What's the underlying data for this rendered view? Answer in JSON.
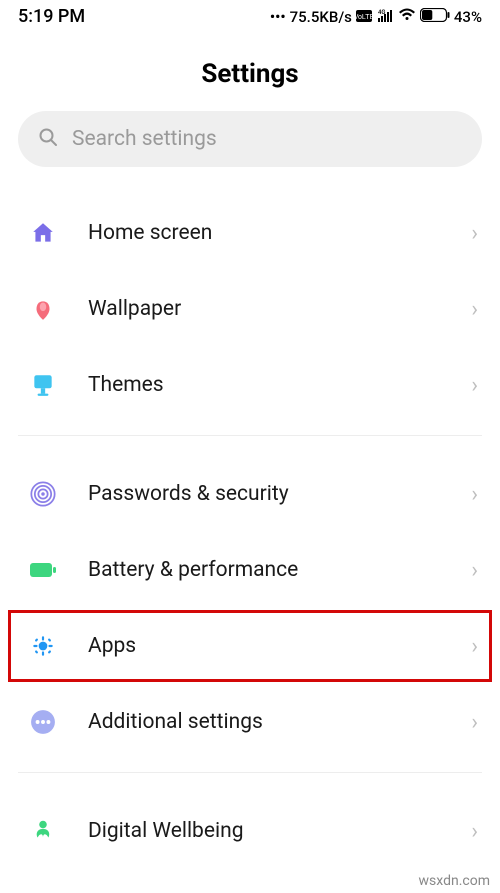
{
  "status": {
    "time": "5:19 PM",
    "speed": "75.5KB/s",
    "battery": "43%"
  },
  "pageTitle": "Settings",
  "search": {
    "placeholder": "Search settings"
  },
  "items": {
    "home": "Home screen",
    "wallpaper": "Wallpaper",
    "themes": "Themes",
    "passwords": "Passwords & security",
    "battery": "Battery & performance",
    "apps": "Apps",
    "additional": "Additional settings",
    "wellbeing": "Digital Wellbeing"
  },
  "chevron": "›",
  "watermark": "wsxdn.com"
}
